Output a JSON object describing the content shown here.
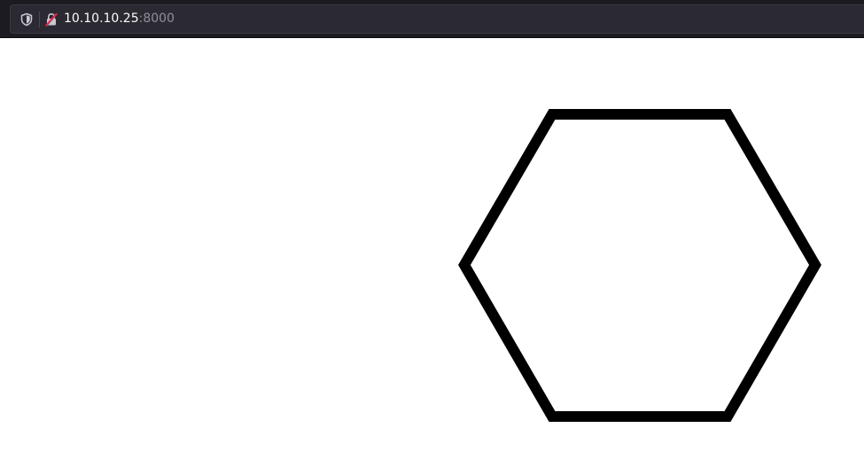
{
  "browser": {
    "url_host": "10.10.10.25",
    "url_port": ":8000",
    "icons": {
      "tracking_protection": "shield-icon",
      "connection": "insecure-lock-icon"
    },
    "colors": {
      "toolbar": "#1c1b22",
      "urlbar": "#2b2a33",
      "insecure_accent": "#e22850"
    }
  },
  "page": {
    "shape": "hexagon",
    "shape_color": "#000000",
    "background": "#ffffff"
  }
}
